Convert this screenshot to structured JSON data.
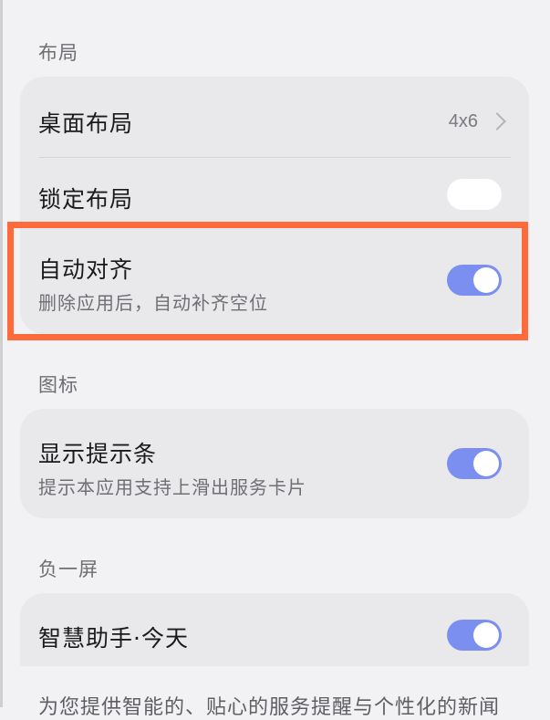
{
  "sections": {
    "layout": {
      "header": "布局",
      "desktop_layout": {
        "label": "桌面布局",
        "value": "4x6"
      },
      "lock_layout": {
        "label": "锁定布局",
        "toggle": "off"
      },
      "auto_align": {
        "label": "自动对齐",
        "description": "删除应用后，自动补齐空位",
        "toggle": "on"
      }
    },
    "icons": {
      "header": "图标",
      "show_hint_bar": {
        "label": "显示提示条",
        "description": "提示本应用支持上滑出服务卡片",
        "toggle": "on"
      }
    },
    "minus_one_screen": {
      "header": "负一屏",
      "smart_assistant": {
        "label": "智慧助手·今天",
        "toggle": "on"
      },
      "description": "为您提供智能的、贴心的服务提醒与个性化的新闻"
    }
  },
  "colors": {
    "toggle_on": "#7b8ff0",
    "toggle_off": "#ffffff",
    "highlight": "#ff6a3a",
    "background": "#f2f2f4",
    "card": "#e9e9ec"
  }
}
